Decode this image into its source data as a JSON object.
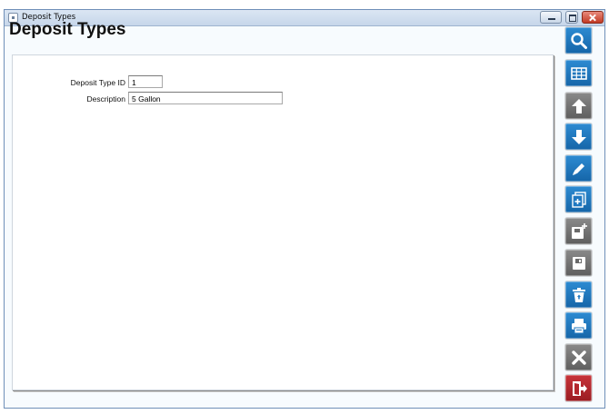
{
  "window": {
    "title": "Deposit Types",
    "controls": [
      "minimize",
      "maximize",
      "close"
    ]
  },
  "page": {
    "title": "Deposit Types"
  },
  "form": {
    "deposit_type_id": {
      "label": "Deposit Type ID",
      "value": "1"
    },
    "description": {
      "label": "Description",
      "value": "5 Gallon"
    }
  },
  "toolbar": {
    "buttons": [
      {
        "name": "search",
        "icon": "search-icon",
        "color": "#1f78c1"
      },
      {
        "name": "grid",
        "icon": "grid-icon",
        "color": "#1f78c1"
      },
      {
        "name": "previous",
        "icon": "arrow-up-icon",
        "color": "#747474"
      },
      {
        "name": "next",
        "icon": "arrow-down-icon",
        "color": "#1f78c1"
      },
      {
        "name": "edit",
        "icon": "pencil-icon",
        "color": "#1f78c1"
      },
      {
        "name": "copy",
        "icon": "copy-icon",
        "color": "#1f78c1"
      },
      {
        "name": "new",
        "icon": "save-new-icon",
        "color": "#747474"
      },
      {
        "name": "save",
        "icon": "save-icon",
        "color": "#747474"
      },
      {
        "name": "delete",
        "icon": "trash-icon",
        "color": "#1f78c1"
      },
      {
        "name": "print",
        "icon": "printer-icon",
        "color": "#1f78c1"
      },
      {
        "name": "cancel",
        "icon": "x-icon",
        "color": "#747474"
      },
      {
        "name": "exit",
        "icon": "exit-door-icon",
        "color": "#b3262c"
      }
    ]
  }
}
